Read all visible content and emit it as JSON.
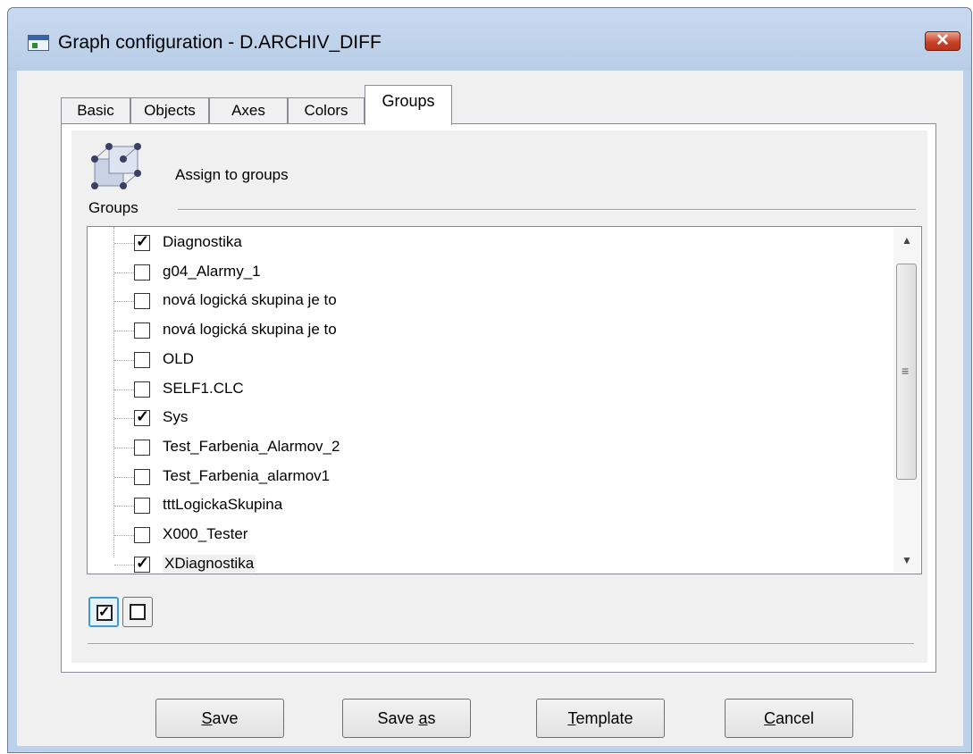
{
  "window": {
    "title": "Graph configuration -  D.ARCHIV_DIFF",
    "close_label": "✕"
  },
  "tabs": [
    {
      "label": "Basic"
    },
    {
      "label": "Objects"
    },
    {
      "label": "Axes"
    },
    {
      "label": "Colors"
    },
    {
      "label": "Groups",
      "active": true
    }
  ],
  "panel": {
    "icon_caption": "Groups",
    "heading": "Assign to groups"
  },
  "groups": [
    {
      "label": "Diagnostika",
      "checked": true
    },
    {
      "label": "g04_Alarmy_1",
      "checked": false
    },
    {
      "label": "nová logická skupina je to",
      "checked": false
    },
    {
      "label": "nová logická skupina je to",
      "checked": false
    },
    {
      "label": "OLD",
      "checked": false
    },
    {
      "label": "SELF1.CLC",
      "checked": false
    },
    {
      "label": "Sys",
      "checked": true
    },
    {
      "label": "Test_Farbenia_Alarmov_2",
      "checked": false
    },
    {
      "label": "Test_Farbenia_alarmov1",
      "checked": false
    },
    {
      "label": "tttLogickaSkupina",
      "checked": false
    },
    {
      "label": "X000_Tester",
      "checked": false
    },
    {
      "label": "XDiagnostika",
      "checked": true,
      "selected": true
    }
  ],
  "buttons": {
    "save": {
      "pre": "",
      "key": "S",
      "post": "ave"
    },
    "save_as": {
      "pre": "Save ",
      "key": "a",
      "post": "s"
    },
    "template": {
      "pre": "",
      "key": "T",
      "post": "emplate"
    },
    "cancel": {
      "pre": "",
      "key": "C",
      "post": "ancel"
    }
  },
  "check_mark": "✓",
  "colors": {
    "titlebar": "#bcd1ea",
    "close": "#c8432a",
    "focus": "#3d9ad6"
  }
}
